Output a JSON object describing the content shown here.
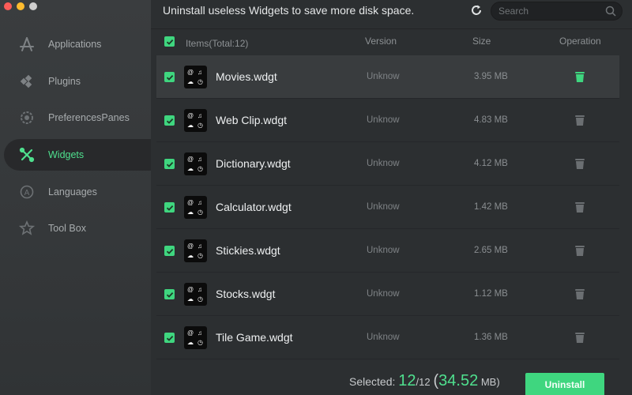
{
  "topbar": {
    "headline": "Uninstall useless Widgets to save more disk space.",
    "search_placeholder": "Search"
  },
  "sidebar": {
    "items": [
      {
        "label": "Applications",
        "icon": "applications-icon",
        "active": false
      },
      {
        "label": "Plugins",
        "icon": "plugins-icon",
        "active": false
      },
      {
        "label": "PreferencesPanes",
        "icon": "preferences-gear-icon",
        "active": false
      },
      {
        "label": "Widgets",
        "icon": "widgets-tools-icon",
        "active": true
      },
      {
        "label": "Languages",
        "icon": "languages-icon",
        "active": false
      },
      {
        "label": "Tool Box",
        "icon": "toolbox-icon",
        "active": false
      }
    ]
  },
  "table": {
    "headers": {
      "items": "Items(Total:12)",
      "version": "Version",
      "size": "Size",
      "operation": "Operation"
    },
    "rows": [
      {
        "name": "Movies.wdgt",
        "version": "Unknow",
        "size": "3.95 MB"
      },
      {
        "name": "Web Clip.wdgt",
        "version": "Unknow",
        "size": "4.83 MB"
      },
      {
        "name": "Dictionary.wdgt",
        "version": "Unknow",
        "size": "4.12 MB"
      },
      {
        "name": "Calculator.wdgt",
        "version": "Unknow",
        "size": "1.42 MB"
      },
      {
        "name": "Stickies.wdgt",
        "version": "Unknow",
        "size": "2.65 MB"
      },
      {
        "name": "Stocks.wdgt",
        "version": "Unknow",
        "size": "1.12 MB"
      },
      {
        "name": "Tile Game.wdgt",
        "version": "Unknow",
        "size": "1.36 MB"
      }
    ]
  },
  "footer": {
    "selected_label": "Selected:",
    "selected_count": "12",
    "total_count": "/12",
    "open_paren": "(",
    "selected_size": "34.52",
    "size_unit": " MB)",
    "uninstall_label": "Uninstall"
  },
  "colors": {
    "accent": "#3fd67f",
    "background": "#2c2f31",
    "sidebar": "#3a3d3f"
  }
}
